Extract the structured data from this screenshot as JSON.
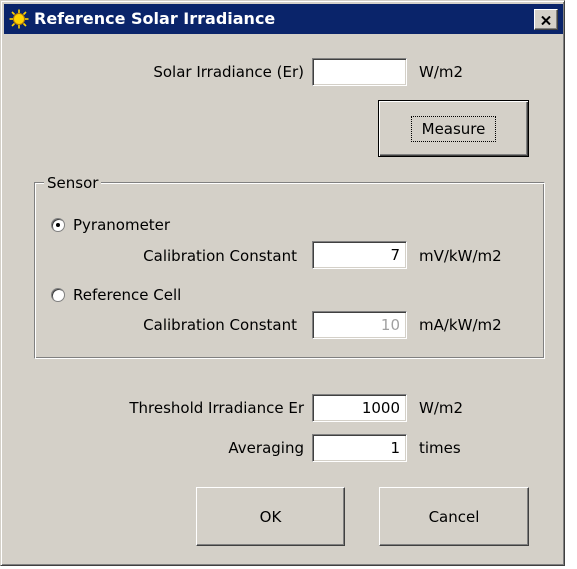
{
  "window": {
    "title": "Reference Solar Irradiance"
  },
  "irradiance": {
    "label": "Solar Irradiance (Er)",
    "value": "",
    "unit": "W/m2"
  },
  "measure_button": "Measure",
  "sensor": {
    "group_label": "Sensor",
    "pyranometer": {
      "label": "Pyranometer",
      "selected": true,
      "constant_label": "Calibration Constant",
      "constant_value": "7",
      "unit": "mV/kW/m2"
    },
    "reference_cell": {
      "label": "Reference Cell",
      "selected": false,
      "constant_label": "Calibration Constant",
      "constant_value": "10",
      "unit": "mA/kW/m2"
    }
  },
  "threshold": {
    "label": "Threshold Irradiance Er",
    "value": "1000",
    "unit": "W/m2"
  },
  "averaging": {
    "label": "Averaging",
    "value": "1",
    "unit": "times"
  },
  "buttons": {
    "ok": "OK",
    "cancel": "Cancel"
  },
  "colors": {
    "titlebar": "#0a246a",
    "face": "#d4d0c8",
    "field": "#ffffff"
  }
}
